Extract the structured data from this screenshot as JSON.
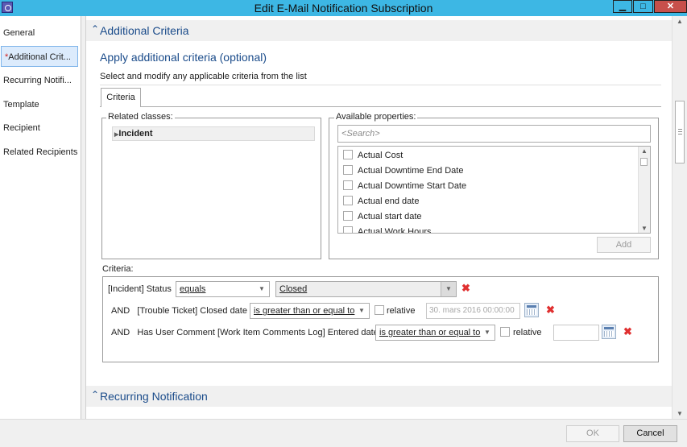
{
  "window": {
    "title": "Edit E-Mail Notification Subscription",
    "minimize_label": "▁",
    "maximize_label": "□",
    "close_label": "✕"
  },
  "nav": {
    "items": [
      {
        "label": "General",
        "required": false
      },
      {
        "label": "Additional Crit...",
        "required": true
      },
      {
        "label": "Recurring Notifi...",
        "required": false
      },
      {
        "label": "Template",
        "required": false
      },
      {
        "label": "Recipient",
        "required": false
      },
      {
        "label": "Related Recipients",
        "required": false
      }
    ],
    "required_marker": "*"
  },
  "additional_criteria": {
    "section_title": "Additional Criteria",
    "heading": "Apply additional criteria (optional)",
    "description": "Select and modify any applicable criteria from the list",
    "tab_label": "Criteria",
    "related_classes": {
      "legend": "Related classes:",
      "items": [
        "Incident"
      ]
    },
    "available_properties": {
      "legend": "Available properties:",
      "search_placeholder": "<Search>",
      "items": [
        "Actual Cost",
        "Actual Downtime End Date",
        "Actual Downtime Start Date",
        "Actual end date",
        "Actual start date",
        "Actual Work Hours"
      ],
      "add_label": "Add"
    },
    "criteria_label": "Criteria:",
    "rows": [
      {
        "prefix": "",
        "class": "[Incident]",
        "property": "Status",
        "operator": "equals",
        "value": "Closed"
      },
      {
        "prefix": "AND",
        "class": "[Trouble Ticket]",
        "property": "Closed date",
        "operator": "is greater than or equal to",
        "relative_label": "relative",
        "date_value": "30. mars 2016 00:00:00"
      },
      {
        "prefix": "AND",
        "class": "Has User Comment [Work Item Comments Log]",
        "property": "Entered date",
        "operator": "is greater than or equal to",
        "relative_label": "relative",
        "date_value": ""
      }
    ]
  },
  "recurring": {
    "section_title": "Recurring Notification"
  },
  "footer": {
    "ok_label": "OK",
    "cancel_label": "Cancel"
  },
  "colors": {
    "titlebar": "#3db7e4",
    "section_text": "#1a4b8a",
    "delete": "#e03030",
    "close": "#c7504b"
  }
}
